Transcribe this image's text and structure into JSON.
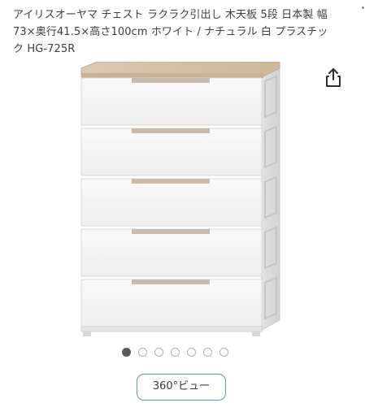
{
  "product": {
    "title": "アイリスオーヤマ チェスト ラクラク引出し 木天板 5段 日本製 幅73×奥行41.5×高さ100cm ホワイト / ナチュラル 白 プラスチック HG-725R",
    "drawer_count": 5,
    "colors": {
      "top_board": "#d6c3a8",
      "body": "#f3f3f3",
      "handle_accent": "#c9bcae"
    }
  },
  "share": {
    "icon": "share-icon"
  },
  "carousel": {
    "total": 7,
    "active_index": 0
  },
  "view_360": {
    "label": "360°ビュー"
  }
}
